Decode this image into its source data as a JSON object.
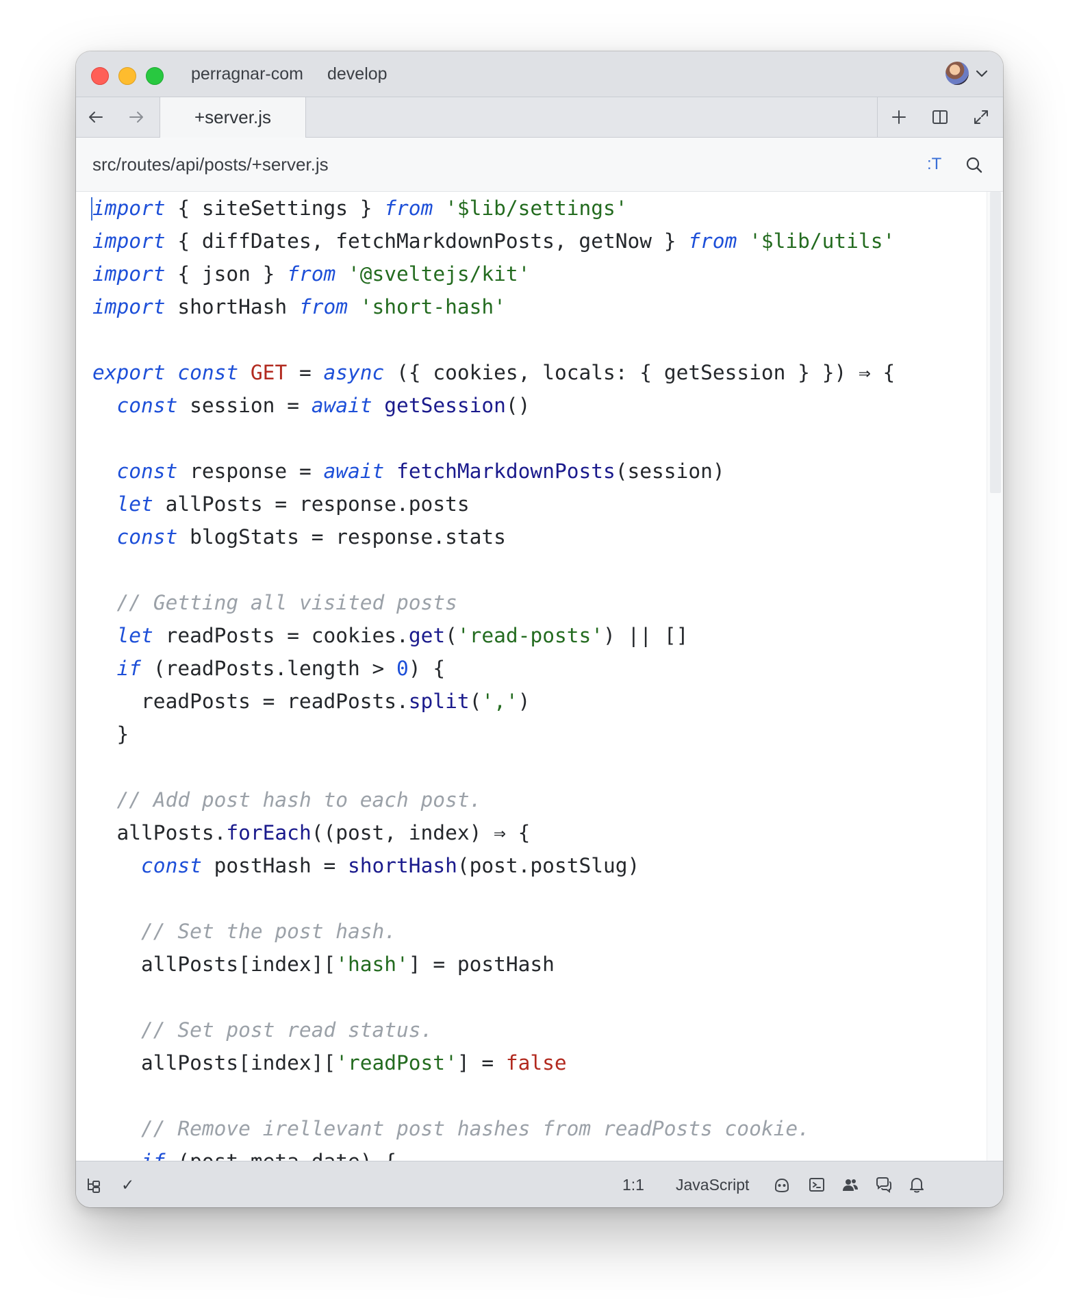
{
  "window": {
    "project": "perragnar-com",
    "branch": "develop"
  },
  "tabs": [
    {
      "label": "+server.js",
      "active": true
    }
  ],
  "breadcrumb": {
    "path": "src/routes/api/posts/+server.js",
    "symbol_button": ":T"
  },
  "editor": {
    "language": "JavaScript",
    "lines": [
      "import { siteSettings } from '$lib/settings'",
      "import { diffDates, fetchMarkdownPosts, getNow } from '$lib/utils'",
      "import { json } from '@sveltejs/kit'",
      "import shortHash from 'short-hash'",
      "",
      "export const GET = async ({ cookies, locals: { getSession } }) ⇒ {",
      "  const session = await getSession()",
      "",
      "  const response = await fetchMarkdownPosts(session)",
      "  let allPosts = response.posts",
      "  const blogStats = response.stats",
      "",
      "  // Getting all visited posts",
      "  let readPosts = cookies.get('read-posts') || []",
      "  if (readPosts.length > 0) {",
      "    readPosts = readPosts.split(',')",
      "  }",
      "",
      "  // Add post hash to each post.",
      "  allPosts.forEach((post, index) ⇒ {",
      "    const postHash = shortHash(post.postSlug)",
      "",
      "    // Set the post hash.",
      "    allPosts[index]['hash'] = postHash",
      "",
      "    // Set post read status.",
      "    allPosts[index]['readPost'] = false",
      "",
      "    // Remove irellevant post hashes from readPosts cookie.",
      "    if (post.meta.date) {"
    ]
  },
  "statusbar": {
    "cursor": "1:1",
    "language": "JavaScript",
    "checkmark": "✓"
  },
  "colors": {
    "keyword": "#1d4fd8",
    "string": "#236b1f",
    "function": "#1a1a8c",
    "constant": "#b22a1f",
    "comment": "#9ba1a8"
  }
}
